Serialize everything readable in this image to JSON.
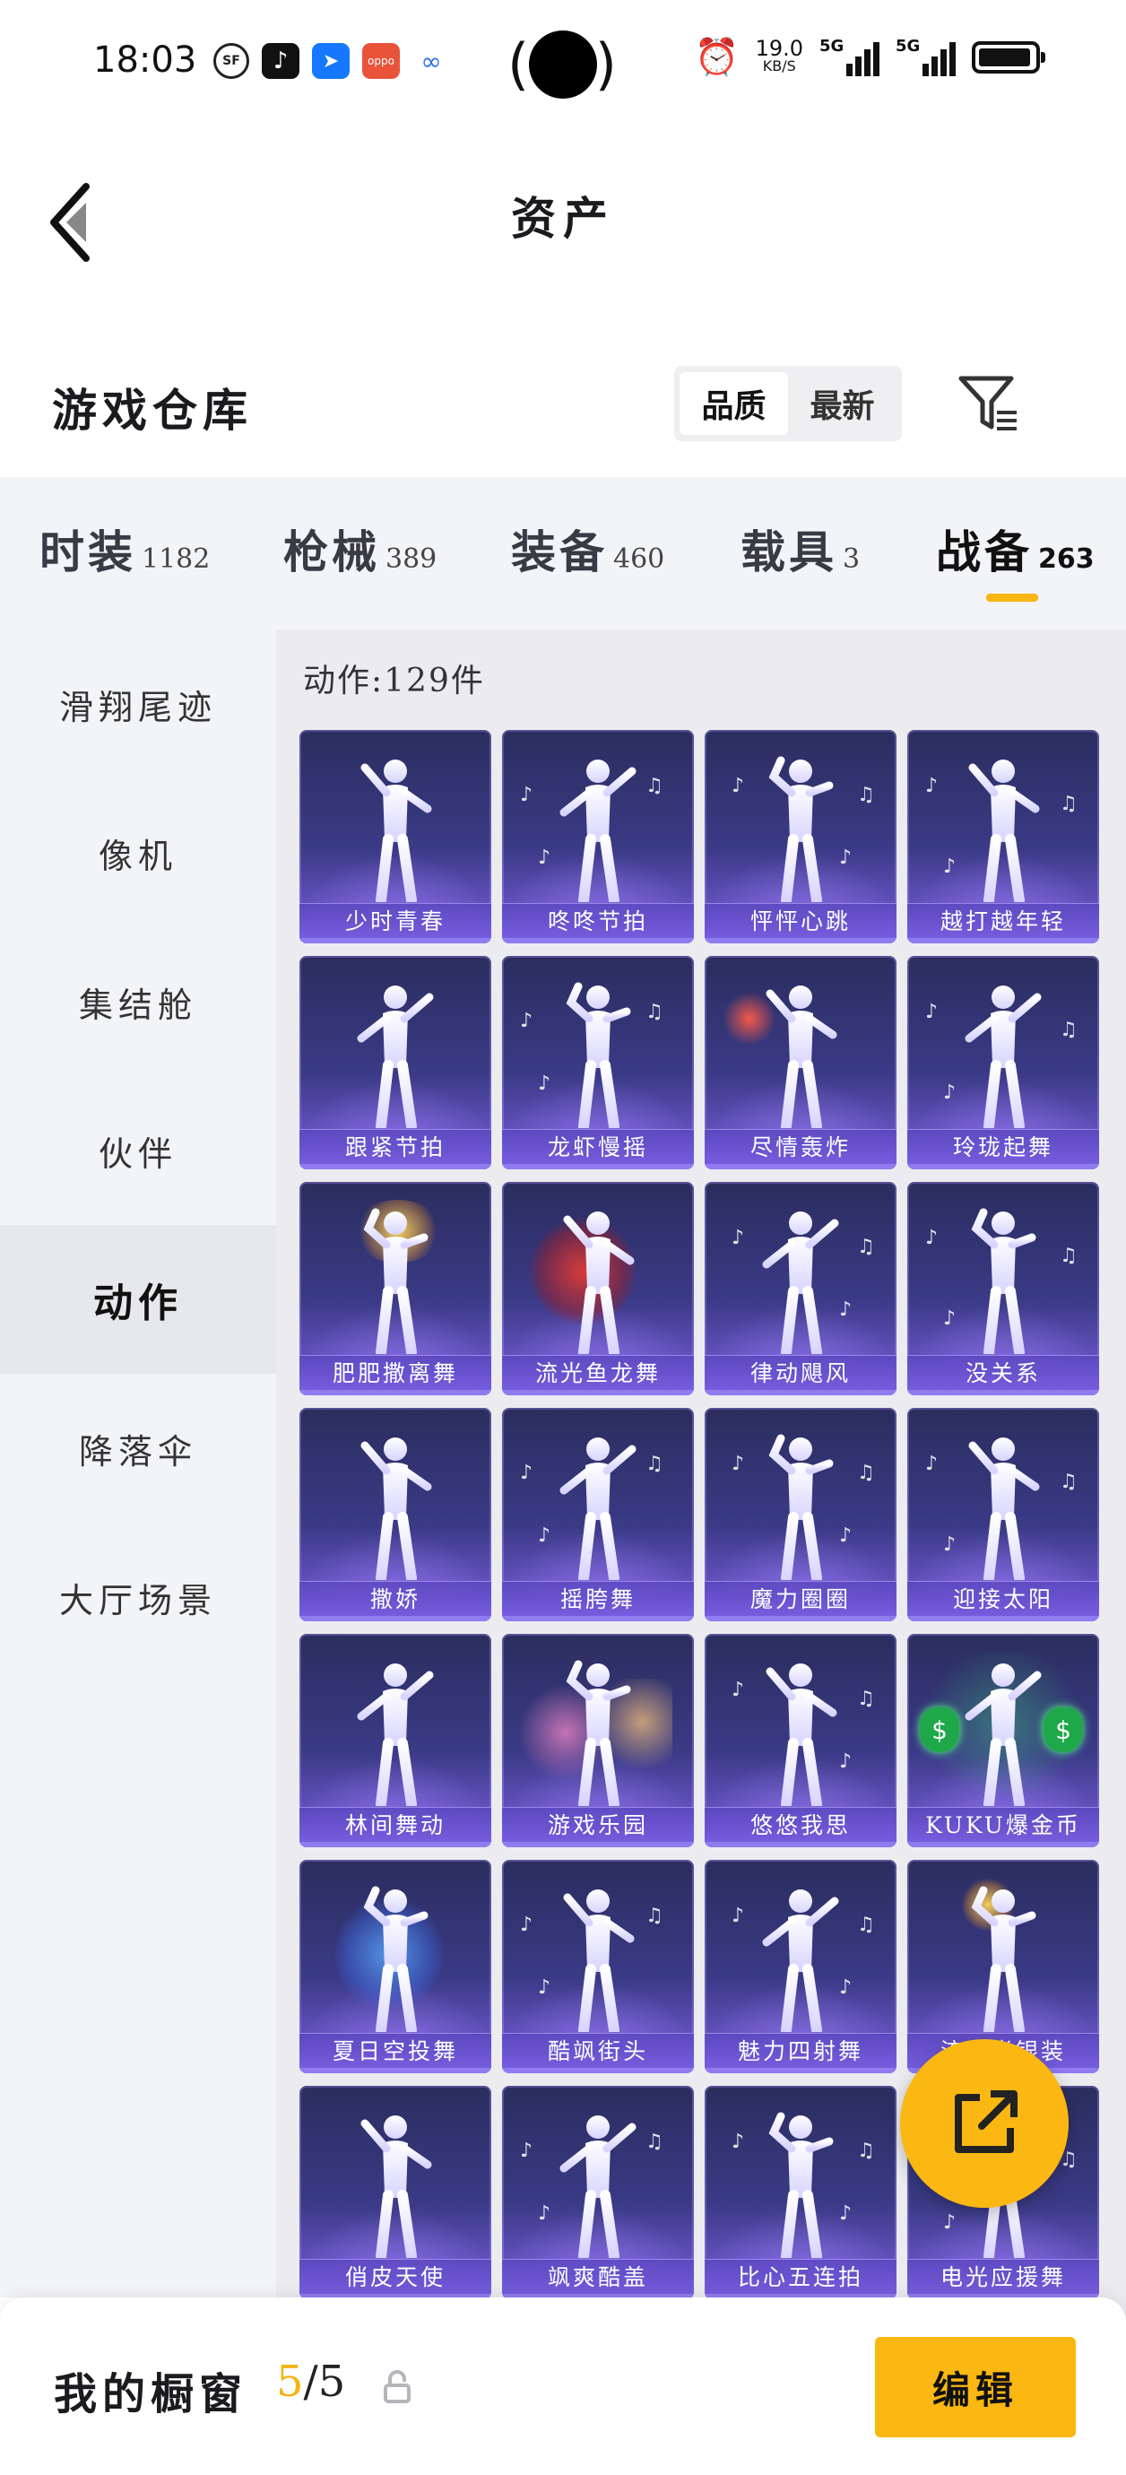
{
  "status_bar": {
    "time": "18:03",
    "apps": [
      "SF",
      "♪",
      "➤",
      "oppo",
      "∞"
    ],
    "net_speed_value": "19.0",
    "net_speed_unit": "KB/S",
    "signal1_label": "5G",
    "signal2_label": "5G",
    "battery_level": 0.95
  },
  "nav": {
    "title": "资产"
  },
  "warehouse": {
    "title": "游戏仓库",
    "sort_options": [
      "品质",
      "最新"
    ],
    "active_sort": 0
  },
  "categories": [
    {
      "name": "时装",
      "count": "1182"
    },
    {
      "name": "枪械",
      "count": "389"
    },
    {
      "name": "装备",
      "count": "460"
    },
    {
      "name": "载具",
      "count": "3"
    },
    {
      "name": "战备",
      "count": "263"
    }
  ],
  "active_category": 4,
  "sidebar": {
    "items": [
      "滑翔尾迹",
      "像机",
      "集结舱",
      "伙伴",
      "动作",
      "降落伞",
      "大厅场景"
    ],
    "active_index": 4
  },
  "content": {
    "count_label": "动作:129件",
    "items": [
      "少时青春",
      "咚咚节拍",
      "怦怦心跳",
      "越打越年轻",
      "跟紧节拍",
      "龙虾慢摇",
      "尽情轰炸",
      "玲珑起舞",
      "肥肥撒离舞",
      "流光鱼龙舞",
      "律动飓风",
      "没关系",
      "撒娇",
      "摇胯舞",
      "魔力圈圈",
      "迎接太阳",
      "林间舞动",
      "游戏乐园",
      "悠悠我思",
      "KUKU爆金币",
      "夏日空投舞",
      "酷飒街头",
      "魅力四射舞",
      "流光尚银装",
      "俏皮天使",
      "飒爽酷盖",
      "比心五连拍",
      "电光应援舞"
    ]
  },
  "bottom_bar": {
    "showcase_title": "我的橱窗",
    "showcase_current": "5",
    "showcase_total": "/5",
    "edit_label": "编辑"
  },
  "colors": {
    "accent": "#fbb712",
    "card_top": "#2b2d5e",
    "card_bottom": "#8a6ae0"
  }
}
